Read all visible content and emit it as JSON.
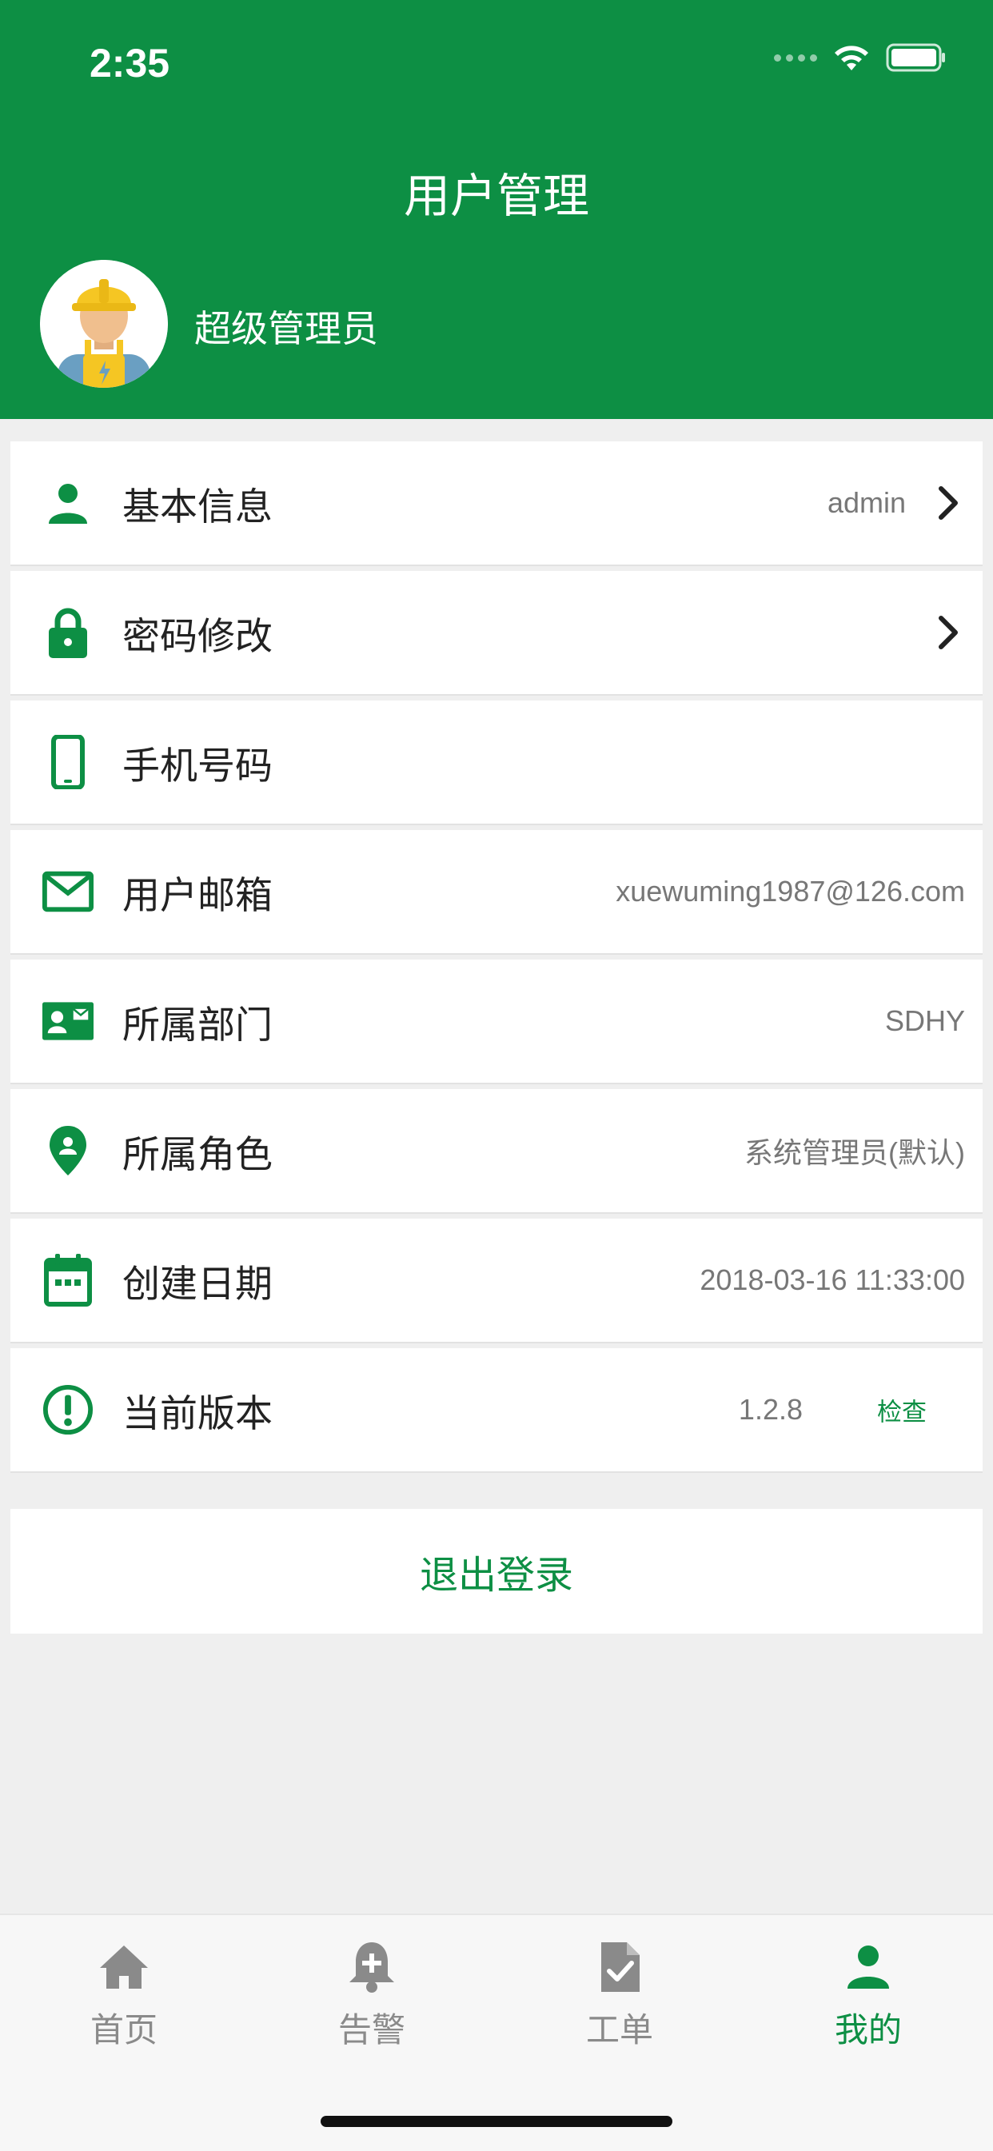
{
  "status_bar": {
    "time": "2:35"
  },
  "header": {
    "title": "用户管理",
    "username": "超级管理员"
  },
  "rows": [
    {
      "label": "基本信息",
      "value": "admin",
      "icon": "person-icon",
      "arrow": true
    },
    {
      "label": "密码修改",
      "value": "",
      "icon": "lock-icon",
      "arrow": true
    },
    {
      "label": "手机号码",
      "value": "",
      "icon": "phone-icon",
      "arrow": false
    },
    {
      "label": "用户邮箱",
      "value": "xuewuming1987@126.com",
      "icon": "mail-icon",
      "arrow": false
    },
    {
      "label": "所属部门",
      "value": "SDHY",
      "icon": "id-card-icon",
      "arrow": false
    },
    {
      "label": "所属角色",
      "value": "系统管理员(默认)",
      "icon": "location-pin-icon",
      "arrow": false
    },
    {
      "label": "创建日期",
      "value": "2018-03-16 11:33:00",
      "icon": "calendar-icon",
      "arrow": false
    },
    {
      "label": "当前版本",
      "value": "1.2.8",
      "icon": "info-icon",
      "arrow": false,
      "action": "检查"
    }
  ],
  "logout_label": "退出登录",
  "tabs": [
    {
      "label": "首页",
      "icon": "home-icon",
      "active": false
    },
    {
      "label": "告警",
      "icon": "alarm-bell-icon",
      "active": false
    },
    {
      "label": "工单",
      "icon": "document-check-icon",
      "active": false
    },
    {
      "label": "我的",
      "icon": "person-icon",
      "active": true
    }
  ],
  "colors": {
    "primary": "#0d8f44",
    "background": "#efefef",
    "inactive_tab": "#8a8a8a"
  }
}
